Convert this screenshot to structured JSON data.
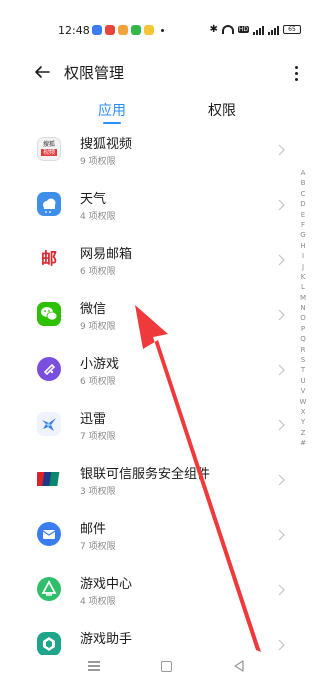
{
  "status": {
    "time": "12:48",
    "battery": "65"
  },
  "header": {
    "title": "权限管理"
  },
  "tabs": [
    {
      "label": "应用"
    },
    {
      "label": "权限"
    }
  ],
  "apps": [
    {
      "name": "搜狐视频",
      "sub": "9 项权限",
      "icon_text_top": "搜狐",
      "icon_text_bottom": "视频"
    },
    {
      "name": "天气",
      "sub": "4 项权限"
    },
    {
      "name": "网易邮箱",
      "sub": "6 项权限",
      "icon_text": "邮"
    },
    {
      "name": "微信",
      "sub": "9 项权限"
    },
    {
      "name": "小游戏",
      "sub": "6 项权限"
    },
    {
      "name": "迅雷",
      "sub": "7 项权限"
    },
    {
      "name": "银联可信服务安全组件",
      "sub": "3 项权限",
      "icon_text": "UnionPay"
    },
    {
      "name": "邮件",
      "sub": "7 项权限"
    },
    {
      "name": "游戏中心",
      "sub": "4 项权限"
    },
    {
      "name": "游戏助手",
      "sub": ""
    }
  ],
  "alphabet": [
    "A",
    "B",
    "C",
    "D",
    "E",
    "F",
    "G",
    "H",
    "I",
    "J",
    "K",
    "L",
    "M",
    "N",
    "O",
    "P",
    "Q",
    "R",
    "S",
    "T",
    "U",
    "V",
    "W",
    "X",
    "Y",
    "Z",
    "#"
  ],
  "colors": {
    "accent": "#2d8cff",
    "arrow": "#f0393b",
    "secondary_text": "#8a8a8a"
  }
}
